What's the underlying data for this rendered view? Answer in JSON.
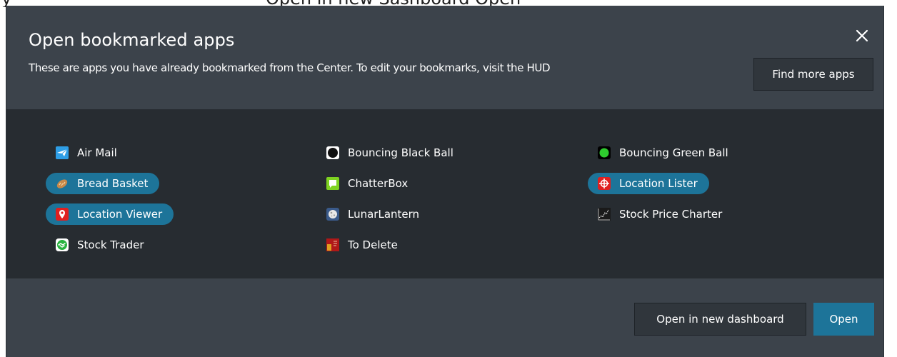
{
  "background": {
    "left_text": "y",
    "middle_text": "Open in new Sashboard  Open"
  },
  "dialog": {
    "title": "Open bookmarked apps",
    "subtitle": "These are apps you have already bookmarked from the Center. To edit your bookmarks, visit the HUD",
    "close_icon": "close-icon",
    "find_more_label": "Find more apps",
    "open_new_dashboard_label": "Open in new dashboard",
    "open_label": "Open",
    "colors": {
      "dialog_bg": "#3c434b",
      "app_area_bg": "#272c31",
      "accent": "#1d7499",
      "text": "#ffffff"
    }
  },
  "apps": [
    {
      "label": "Air Mail",
      "icon": "air-mail-icon",
      "selected": false
    },
    {
      "label": "Bouncing Black Ball",
      "icon": "black-ball-icon",
      "selected": false
    },
    {
      "label": "Bouncing Green Ball",
      "icon": "green-ball-icon",
      "selected": false
    },
    {
      "label": "Bread Basket",
      "icon": "bread-icon",
      "selected": true
    },
    {
      "label": "ChatterBox",
      "icon": "chat-icon",
      "selected": false
    },
    {
      "label": "Location Lister",
      "icon": "crosshair-icon",
      "selected": true
    },
    {
      "label": "Location Viewer",
      "icon": "map-pin-icon",
      "selected": true
    },
    {
      "label": "LunarLantern",
      "icon": "moon-icon",
      "selected": false
    },
    {
      "label": "Stock Price Charter",
      "icon": "stock-chart-icon",
      "selected": false
    },
    {
      "label": "Stock Trader",
      "icon": "handshake-icon",
      "selected": false
    },
    {
      "label": "To Delete",
      "icon": "book-icon",
      "selected": false
    }
  ]
}
